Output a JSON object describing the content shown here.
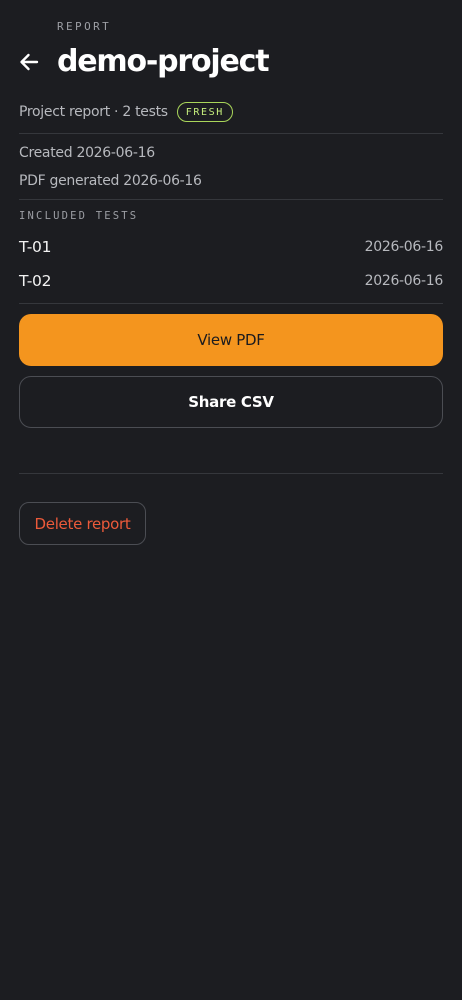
{
  "header": {
    "eyebrow": "REPORT",
    "title": "demo-project",
    "back_icon": "arrow-left-icon"
  },
  "summary": {
    "subtitle": "Project report · 2 tests",
    "badge": "FRESH",
    "badge_color": "#c6ef7d"
  },
  "meta": {
    "created": "Created 2026-06-16",
    "pdf_generated": "PDF generated 2026-06-16"
  },
  "tests": {
    "label": "INCLUDED TESTS",
    "items": [
      {
        "id": "T-01",
        "date": "2026-06-16"
      },
      {
        "id": "T-02",
        "date": "2026-06-16"
      }
    ]
  },
  "actions": {
    "view_pdf": "View PDF",
    "share_csv": "Share CSV",
    "delete": "Delete report",
    "primary_color": "#f4951e",
    "danger_color": "#ec5a3a"
  }
}
